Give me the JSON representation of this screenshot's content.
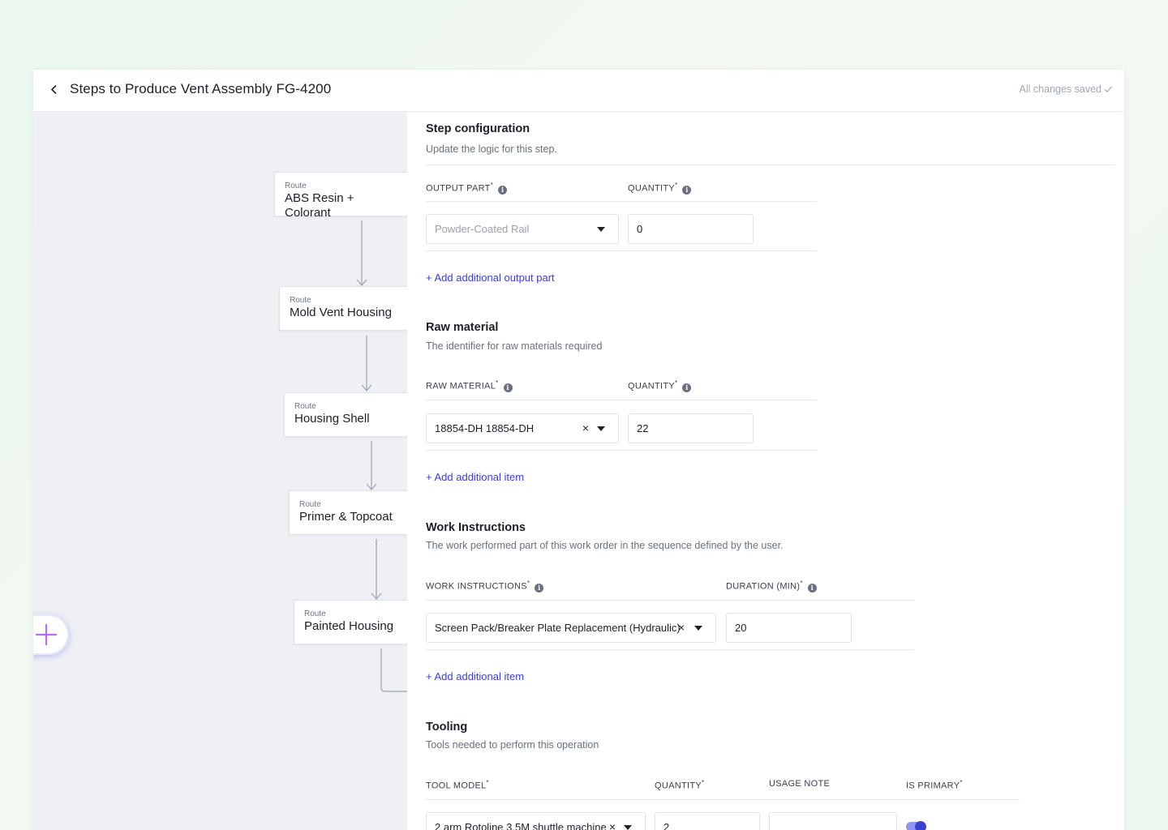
{
  "header": {
    "title": "Steps to Produce Vent Assembly FG-4200",
    "status": "All changes saved",
    "back_icon": "chevron-left-icon"
  },
  "flow": {
    "nodes": [
      {
        "kicker": "Route",
        "name": "ABS Resin + Colorant"
      },
      {
        "kicker": "Route",
        "name": "Mold Vent Housing"
      },
      {
        "kicker": "Route",
        "name": "Housing Shell"
      },
      {
        "kicker": "Route",
        "name": "Primer & Topcoat"
      },
      {
        "kicker": "Route",
        "name": "Painted Housing"
      }
    ],
    "add_icon": "plus-icon"
  },
  "step_config": {
    "title": "Step configuration",
    "subtitle": "Update the logic for this step.",
    "output_part_label": "OUTPUT PART",
    "quantity_label": "QUANTITY",
    "output_part_placeholder": "Powder-Coated Rail",
    "quantity_value": "0",
    "add_link": "+ Add additional output part"
  },
  "raw_material": {
    "title": "Raw material",
    "subtitle": "The identifier for raw materials required",
    "material_label": "RAW MATERIAL",
    "quantity_label": "QUANTITY",
    "material_value": "18854-DH 18854-DH",
    "quantity_value": "22",
    "add_link": "+ Add additional item"
  },
  "work_instructions": {
    "title": "Work Instructions",
    "subtitle": "The work performed part of this work order in the sequence defined by the user.",
    "instructions_label": "WORK INSTRUCTIONS",
    "duration_label": "DURATION (MIN)",
    "instruction_value": "Screen Pack/Breaker Plate Replacement (Hydraulic)",
    "duration_value": "20",
    "add_link": "+ Add additional item"
  },
  "tooling": {
    "title": "Tooling",
    "subtitle": "Tools needed to perform this operation",
    "tool_model_label": "TOOL MODEL",
    "quantity_label": "QUANTITY",
    "usage_note_label": "USAGE NOTE",
    "is_primary_label": "IS PRIMARY",
    "tool_model_value": "2 arm Rotoline 3.5M shuttle machine",
    "quantity_value": "2",
    "usage_note_value": "",
    "is_primary": true
  },
  "colors": {
    "accent": "#3b3fd0",
    "canvas_bg": "#eef0f4",
    "fab_plus": "#b36bf0"
  }
}
